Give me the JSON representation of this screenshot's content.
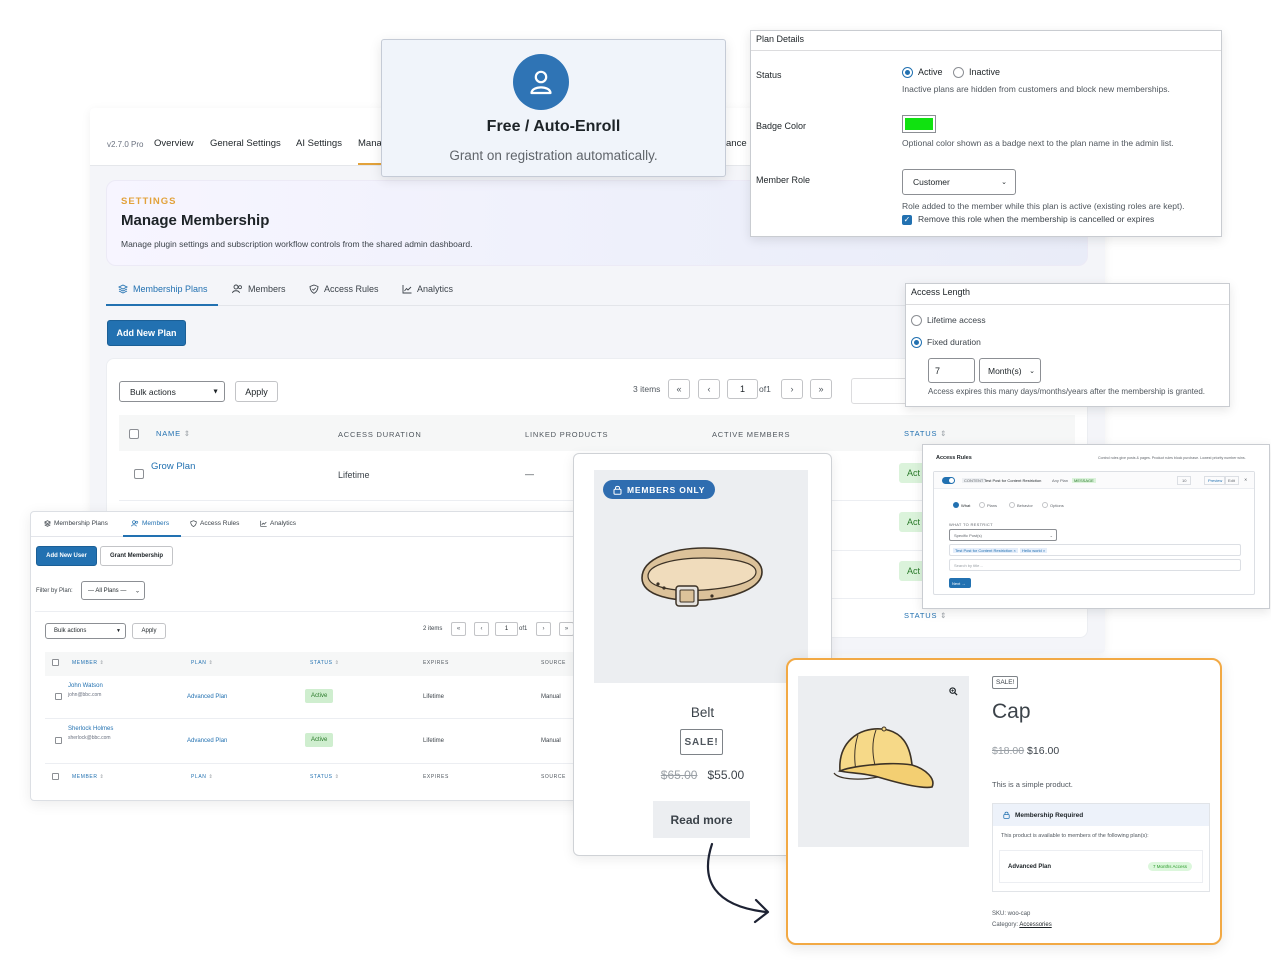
{
  "colors": {
    "accent": "#2271b1",
    "eyebrow": "#e2a23b",
    "badge_green": "#10e210",
    "cap_border": "#f2a944",
    "status_bg": "#dbf3db"
  },
  "main": {
    "version": "v2.7.0 Pro",
    "nav": [
      "Overview",
      "General Settings",
      "AI Settings",
      "Mana",
      "ance"
    ],
    "eyebrow": "SETTINGS",
    "title": "Manage Membership",
    "subtitle": "Manage plugin settings and subscription workflow controls from the shared admin dashboard.",
    "tabs": [
      "Membership Plans",
      "Members",
      "Access Rules",
      "Analytics"
    ],
    "add_button": "Add New Plan",
    "bulk_actions": "Bulk actions",
    "apply": "Apply",
    "items_count": "3 items",
    "page_current": "1",
    "page_of": "of1",
    "pager": [
      "«",
      "‹",
      "›",
      "»"
    ],
    "columns": [
      "NAME",
      "ACCESS DURATION",
      "LINKED PRODUCTS",
      "ACTIVE MEMBERS",
      "STATUS"
    ],
    "rows": [
      {
        "name": "Grow Plan",
        "duration": "Lifetime",
        "products": "—",
        "status": "Act"
      },
      {
        "status": "Act"
      },
      {
        "status": "Act"
      }
    ],
    "footer_status": "STATUS"
  },
  "autoenroll": {
    "icon": "user-icon",
    "title": "Free / Auto-Enroll",
    "subtitle": "Grant on registration automatically."
  },
  "plan_details": {
    "heading": "Plan Details",
    "status_label": "Status",
    "active": "Active",
    "inactive": "Inactive",
    "status_help": "Inactive plans are hidden from customers and block new memberships.",
    "badge_label": "Badge Color",
    "badge_help": "Optional color shown as a badge next to the plan name in the admin list.",
    "role_label": "Member Role",
    "role_value": "Customer",
    "role_help": "Role added to the member while this plan is active (existing roles are kept).",
    "remove_role": "Remove this role when the membership is cancelled or expires"
  },
  "access_length": {
    "heading": "Access Length",
    "lifetime": "Lifetime access",
    "fixed": "Fixed duration",
    "amount": "7",
    "unit": "Month(s)",
    "help": "Access expires this many days/months/years after the membership is granted."
  },
  "access_rules": {
    "heading": "Access Rules",
    "header_note": "Control rules give posts & pages. Product rules block purchase. Lowest priority number wins.",
    "content_label": "CONTENT",
    "rule_name": "Test Post for Content Restriction",
    "plan_text": "Any Plan",
    "message_tag": "MESSAGE",
    "priority": "10",
    "preview": "Preview",
    "edit": "Edit",
    "steps": [
      "What",
      "Plans",
      "Behavior",
      "Options"
    ],
    "what_label": "WHAT TO RESTRICT",
    "what_value": "Specific Post(s)",
    "chips": [
      "Test Post for Content Restriction ×",
      "Hello world ×"
    ],
    "search_placeholder": "Search by title…",
    "next": "Next →"
  },
  "members": {
    "tabs": [
      "Membership Plans",
      "Members",
      "Access Rules",
      "Analytics"
    ],
    "add_user": "Add New User",
    "grant": "Grant Membership",
    "filter_label": "Filter by Plan:",
    "filter_value": "— All Plans —",
    "bulk_actions": "Bulk actions",
    "apply": "Apply",
    "items_count": "2 items",
    "page_current": "1",
    "page_of": "of1",
    "pager": [
      "«",
      "‹",
      "›",
      "»"
    ],
    "columns": [
      "MEMBER",
      "PLAN",
      "STATUS",
      "EXPIRES",
      "SOURCE"
    ],
    "rows": [
      {
        "name": "John Watson",
        "email": "john@bbc.com",
        "plan": "Advanced Plan",
        "status": "Active",
        "expires": "Lifetime",
        "source": "Manual"
      },
      {
        "name": "Sherlock Holmes",
        "email": "sherlock@bbc.com",
        "plan": "Advanced Plan",
        "status": "Active",
        "expires": "Lifetime",
        "source": "Manual"
      }
    ]
  },
  "belt": {
    "badge": "MEMBERS ONLY",
    "name": "Belt",
    "sale": "SALE!",
    "price_old": "$65.00",
    "price_new": "$55.00",
    "button": "Read more"
  },
  "cap": {
    "sale": "SALE!",
    "name": "Cap",
    "price_old": "$18.00",
    "price_new": "$16.00",
    "description": "This is a simple product.",
    "required_heading": "Membership Required",
    "required_text": "This product is available to members of the following plan(s):",
    "plan_name": "Advanced Plan",
    "plan_badge": "7 Months Access",
    "sku": "SKU: woo-cap",
    "category_label": "Category:",
    "category_link": "Accessories"
  }
}
